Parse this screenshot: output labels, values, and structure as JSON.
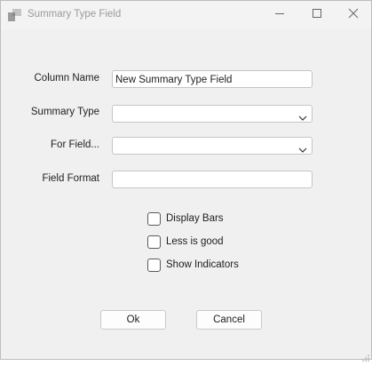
{
  "window": {
    "title": "Summary Type Field",
    "icon": "app-icon",
    "controls": [
      "minimize-icon",
      "maximize-icon",
      "close-icon"
    ]
  },
  "form": {
    "column_name": {
      "label": "Column Name",
      "value": "New Summary Type Field"
    },
    "summary_type": {
      "label": "Summary Type",
      "value": ""
    },
    "for_field": {
      "label": "For Field...",
      "value": ""
    },
    "field_format": {
      "label": "Field Format",
      "value": ""
    }
  },
  "options": {
    "display_bars": {
      "label": "Display Bars",
      "checked": false
    },
    "less_is_good": {
      "label": "Less is good",
      "checked": false
    },
    "show_indicators": {
      "label": "Show Indicators",
      "checked": false
    }
  },
  "buttons": {
    "ok": "Ok",
    "cancel": "Cancel"
  },
  "colors": {
    "window_bg": "#f0f0f0",
    "title_text": "#9a9a9a",
    "field_border": "#c5c5c5"
  }
}
